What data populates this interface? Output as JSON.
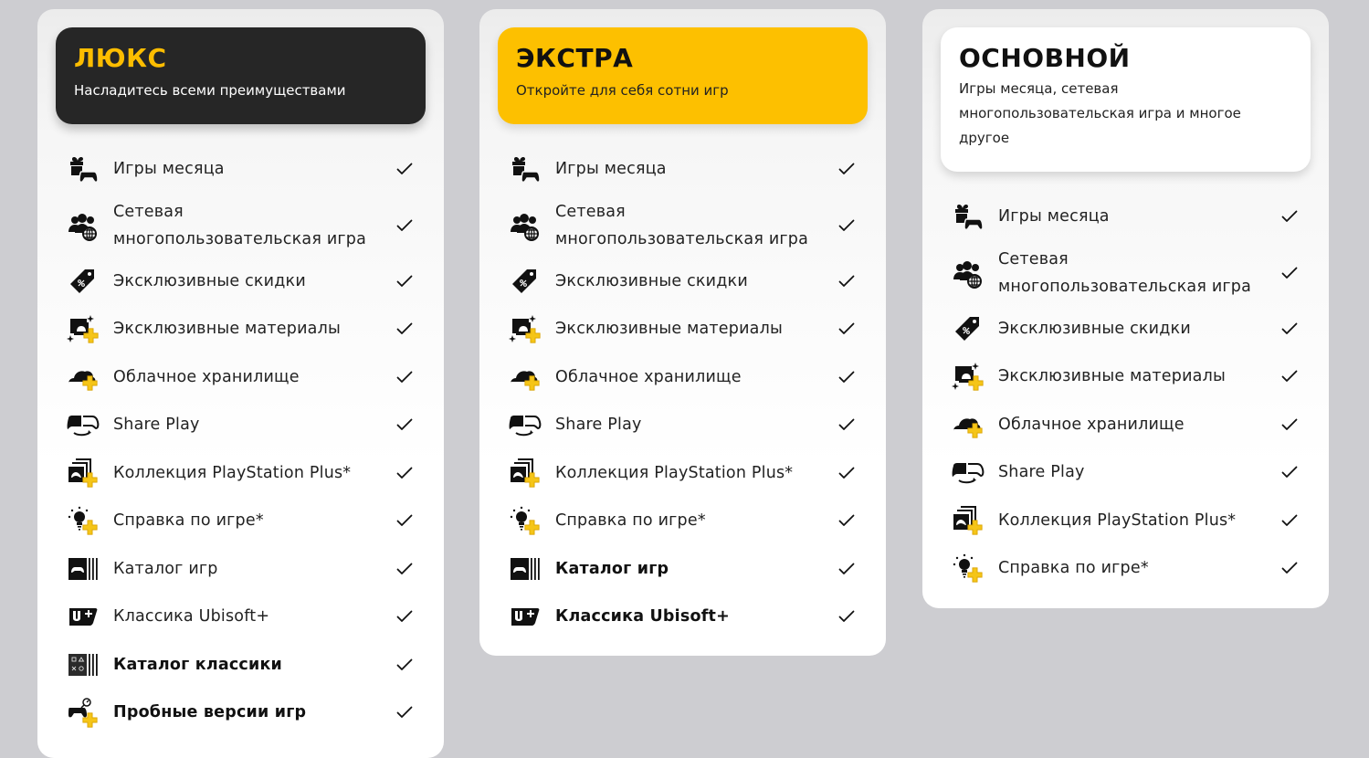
{
  "colors": {
    "background": "#cdcdd1",
    "deluxe_header": "#262626",
    "deluxe_title": "#fdbd00",
    "extra_header": "#fdc000",
    "essential_header": "#ffffff",
    "plus_badge": "#f5c518"
  },
  "plans": [
    {
      "title": "ЛЮКС",
      "subtitle": "Насладитесь всеми преимуществами",
      "features": [
        {
          "label": "Игры месяца",
          "icon": "gift-controller-icon",
          "included": true
        },
        {
          "label": "Сетевая многопользовательская игра",
          "icon": "multiplayer-globe-icon",
          "included": true
        },
        {
          "label": "Эксклюзивные скидки",
          "icon": "discount-tag-icon",
          "included": true
        },
        {
          "label": "Эксклюзивные материалы",
          "icon": "exclusive-content-icon",
          "included": true
        },
        {
          "label": "Облачное хранилище",
          "icon": "cloud-storage-icon",
          "included": true
        },
        {
          "label": "Share Play",
          "icon": "share-play-icon",
          "included": true
        },
        {
          "label": "Коллекция PlayStation Plus*",
          "icon": "collection-icon",
          "included": true
        },
        {
          "label": "Справка по игре*",
          "icon": "game-help-bulb-icon",
          "included": true
        },
        {
          "label": "Каталог игр",
          "icon": "game-catalog-icon",
          "included": true
        },
        {
          "label": "Классика Ubisoft+",
          "icon": "ubisoft-plus-icon",
          "included": true
        },
        {
          "label": "Каталог классики",
          "icon": "classics-catalog-icon",
          "included": true
        },
        {
          "label": "Пробные версии игр",
          "icon": "game-trials-icon",
          "included": true
        }
      ]
    },
    {
      "title": "ЭКСТРА",
      "subtitle": "Откройте для себя сотни игр",
      "features": [
        {
          "label": "Игры месяца",
          "icon": "gift-controller-icon",
          "included": true
        },
        {
          "label": "Сетевая многопользовательская игра",
          "icon": "multiplayer-globe-icon",
          "included": true
        },
        {
          "label": "Эксклюзивные скидки",
          "icon": "discount-tag-icon",
          "included": true
        },
        {
          "label": "Эксклюзивные материалы",
          "icon": "exclusive-content-icon",
          "included": true
        },
        {
          "label": "Облачное хранилище",
          "icon": "cloud-storage-icon",
          "included": true
        },
        {
          "label": "Share Play",
          "icon": "share-play-icon",
          "included": true
        },
        {
          "label": "Коллекция PlayStation Plus*",
          "icon": "collection-icon",
          "included": true
        },
        {
          "label": "Справка по игре*",
          "icon": "game-help-bulb-icon",
          "included": true
        },
        {
          "label": "Каталог игр",
          "icon": "game-catalog-icon",
          "included": true
        },
        {
          "label": "Классика Ubisoft+",
          "icon": "ubisoft-plus-icon",
          "included": true
        }
      ]
    },
    {
      "title": "ОСНОВНОЙ",
      "subtitle": "Игры месяца, сетевая многопользовательская игра и многое другое",
      "features": [
        {
          "label": "Игры месяца",
          "icon": "gift-controller-icon",
          "included": true
        },
        {
          "label": "Сетевая многопользовательская игра",
          "icon": "multiplayer-globe-icon",
          "included": true
        },
        {
          "label": "Эксклюзивные скидки",
          "icon": "discount-tag-icon",
          "included": true
        },
        {
          "label": "Эксклюзивные материалы",
          "icon": "exclusive-content-icon",
          "included": true
        },
        {
          "label": "Облачное хранилище",
          "icon": "cloud-storage-icon",
          "included": true
        },
        {
          "label": "Share Play",
          "icon": "share-play-icon",
          "included": true
        },
        {
          "label": "Коллекция PlayStation Plus*",
          "icon": "collection-icon",
          "included": true
        },
        {
          "label": "Справка по игре*",
          "icon": "game-help-bulb-icon",
          "included": true
        }
      ]
    }
  ]
}
